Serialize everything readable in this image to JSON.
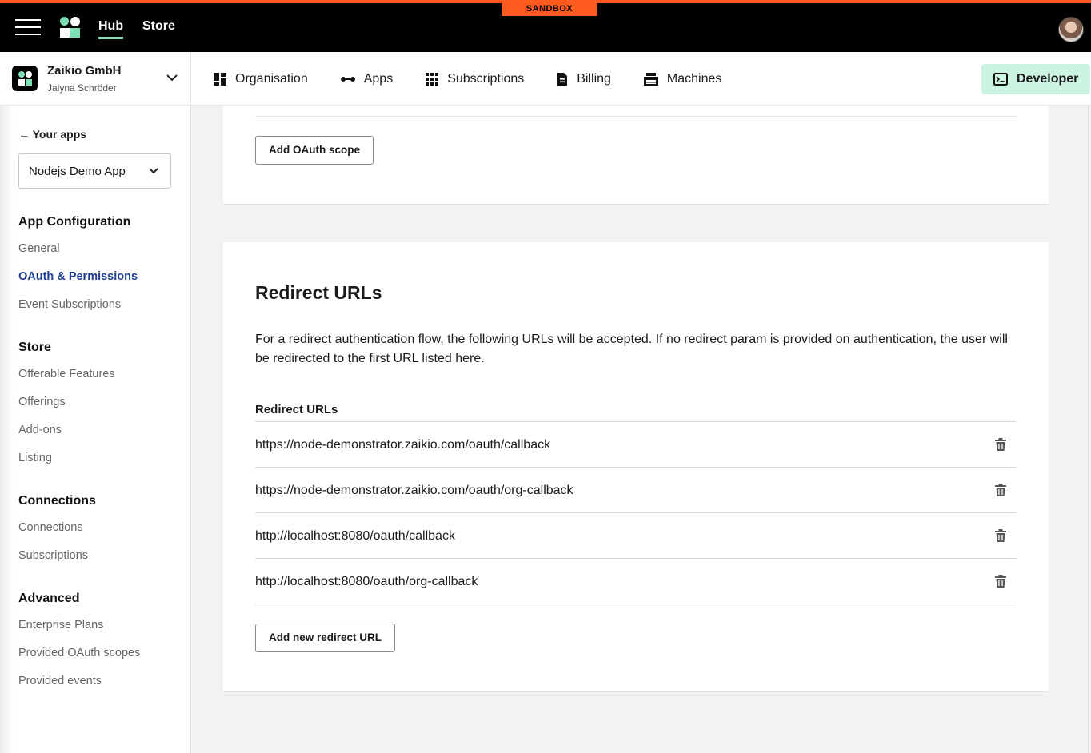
{
  "topbar": {
    "badge": "SANDBOX",
    "nav": {
      "hub": "Hub",
      "store": "Store"
    },
    "accent_color": "#ff5a1f",
    "active_underline_color": "#7de0b4"
  },
  "org": {
    "name": "Zaikio GmbH",
    "user": "Jalyna Schröder"
  },
  "mainnav": {
    "organisation": "Organisation",
    "apps": "Apps",
    "subscriptions": "Subscriptions",
    "billing": "Billing",
    "machines": "Machines",
    "developer": "Developer"
  },
  "sidebar": {
    "back": "← Your apps",
    "app_select": "Nodejs Demo App",
    "sections": [
      {
        "title": "App Configuration",
        "items": [
          "General",
          "OAuth & Permissions",
          "Event Subscriptions"
        ]
      },
      {
        "title": "Store",
        "items": [
          "Offerable Features",
          "Offerings",
          "Add-ons",
          "Listing"
        ]
      },
      {
        "title": "Connections",
        "items": [
          "Connections",
          "Subscriptions"
        ]
      },
      {
        "title": "Advanced",
        "items": [
          "Enterprise Plans",
          "Provided OAuth scopes",
          "Provided events"
        ]
      }
    ],
    "active_item": "OAuth & Permissions"
  },
  "oauth_scopes": {
    "add_button": "Add OAuth scope"
  },
  "redirect": {
    "heading": "Redirect URLs",
    "description": "For a redirect authentication flow, the following URLs will be accepted. If no redirect param is provided on authentication, the user will be redirected to the first URL listed here.",
    "list_title": "Redirect URLs",
    "urls": [
      "https://node-demonstrator.zaikio.com/oauth/callback",
      "https://node-demonstrator.zaikio.com/oauth/org-callback",
      "http://localhost:8080/oauth/callback",
      "http://localhost:8080/oauth/org-callback"
    ],
    "add_button": "Add new redirect URL"
  }
}
